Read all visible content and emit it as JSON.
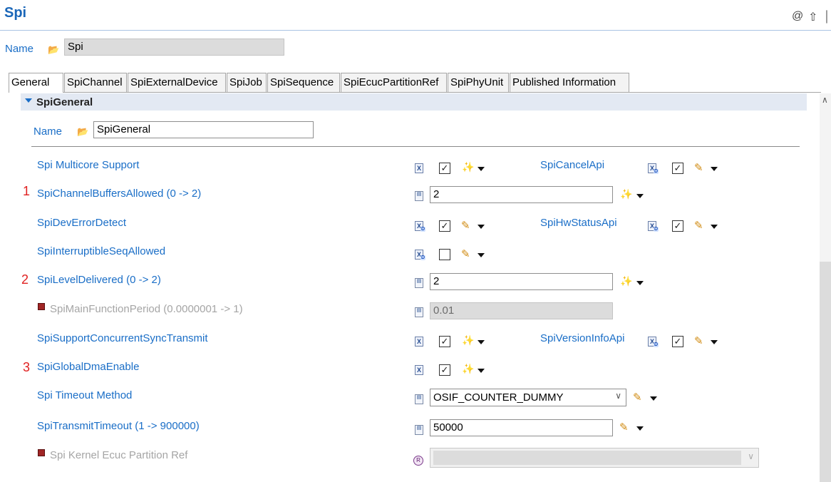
{
  "editor": {
    "title": "Spi",
    "name_label": "Name",
    "name_value": "Spi",
    "toolbar_icons": [
      "at-icon",
      "home-arrow-icon"
    ]
  },
  "tabs": [
    {
      "label": "General",
      "active": true
    },
    {
      "label": "SpiChannel"
    },
    {
      "label": "SpiExternalDevice"
    },
    {
      "label": "SpiJob"
    },
    {
      "label": "SpiSequence"
    },
    {
      "label": "SpiEcucPartitionRef"
    },
    {
      "label": "SpiPhyUnit"
    },
    {
      "label": "Published Information"
    }
  ],
  "section": {
    "title": "SpiGeneral",
    "name_label": "Name",
    "name_value": "SpiGeneral"
  },
  "annotations": [
    "1",
    "2",
    "3"
  ],
  "params": {
    "multicore": {
      "label": "Spi Multicore Support",
      "checked": true
    },
    "cancel_api": {
      "label": "SpiCancelApi",
      "checked": true
    },
    "channel_buffers": {
      "label": "SpiChannelBuffersAllowed (0 -> 2)",
      "value": "2"
    },
    "dev_error": {
      "label": "SpiDevErrorDetect",
      "checked": true
    },
    "hw_status": {
      "label": "SpiHwStatusApi",
      "checked": true
    },
    "interruptible": {
      "label": "SpiInterruptibleSeqAllowed",
      "checked": false
    },
    "level_delivered": {
      "label": "SpiLevelDelivered (0 -> 2)",
      "value": "2"
    },
    "main_function": {
      "label": "SpiMainFunctionPeriod (0.0000001 -> 1)",
      "value": "0.01",
      "disabled": true
    },
    "concurrent": {
      "label": "SpiSupportConcurrentSyncTransmit",
      "checked": true
    },
    "version_info": {
      "label": "SpiVersionInfoApi",
      "checked": true
    },
    "global_dma": {
      "label": "SpiGlobalDmaEnable",
      "checked": true
    },
    "timeout_method": {
      "label": "Spi Timeout Method",
      "value": "OSIF_COUNTER_DUMMY"
    },
    "transmit_timeout": {
      "label": "SpiTransmitTimeout (1 -> 900000)",
      "value": "50000"
    },
    "kernel_ref": {
      "label": "Spi Kernel Ecuc Partition Ref",
      "value": "",
      "disabled": true
    }
  },
  "colors": {
    "link_blue": "#1a6ec7",
    "title_blue": "#1a66b8",
    "annotation_red": "#e02020",
    "section_bg": "#e3e9f3"
  }
}
